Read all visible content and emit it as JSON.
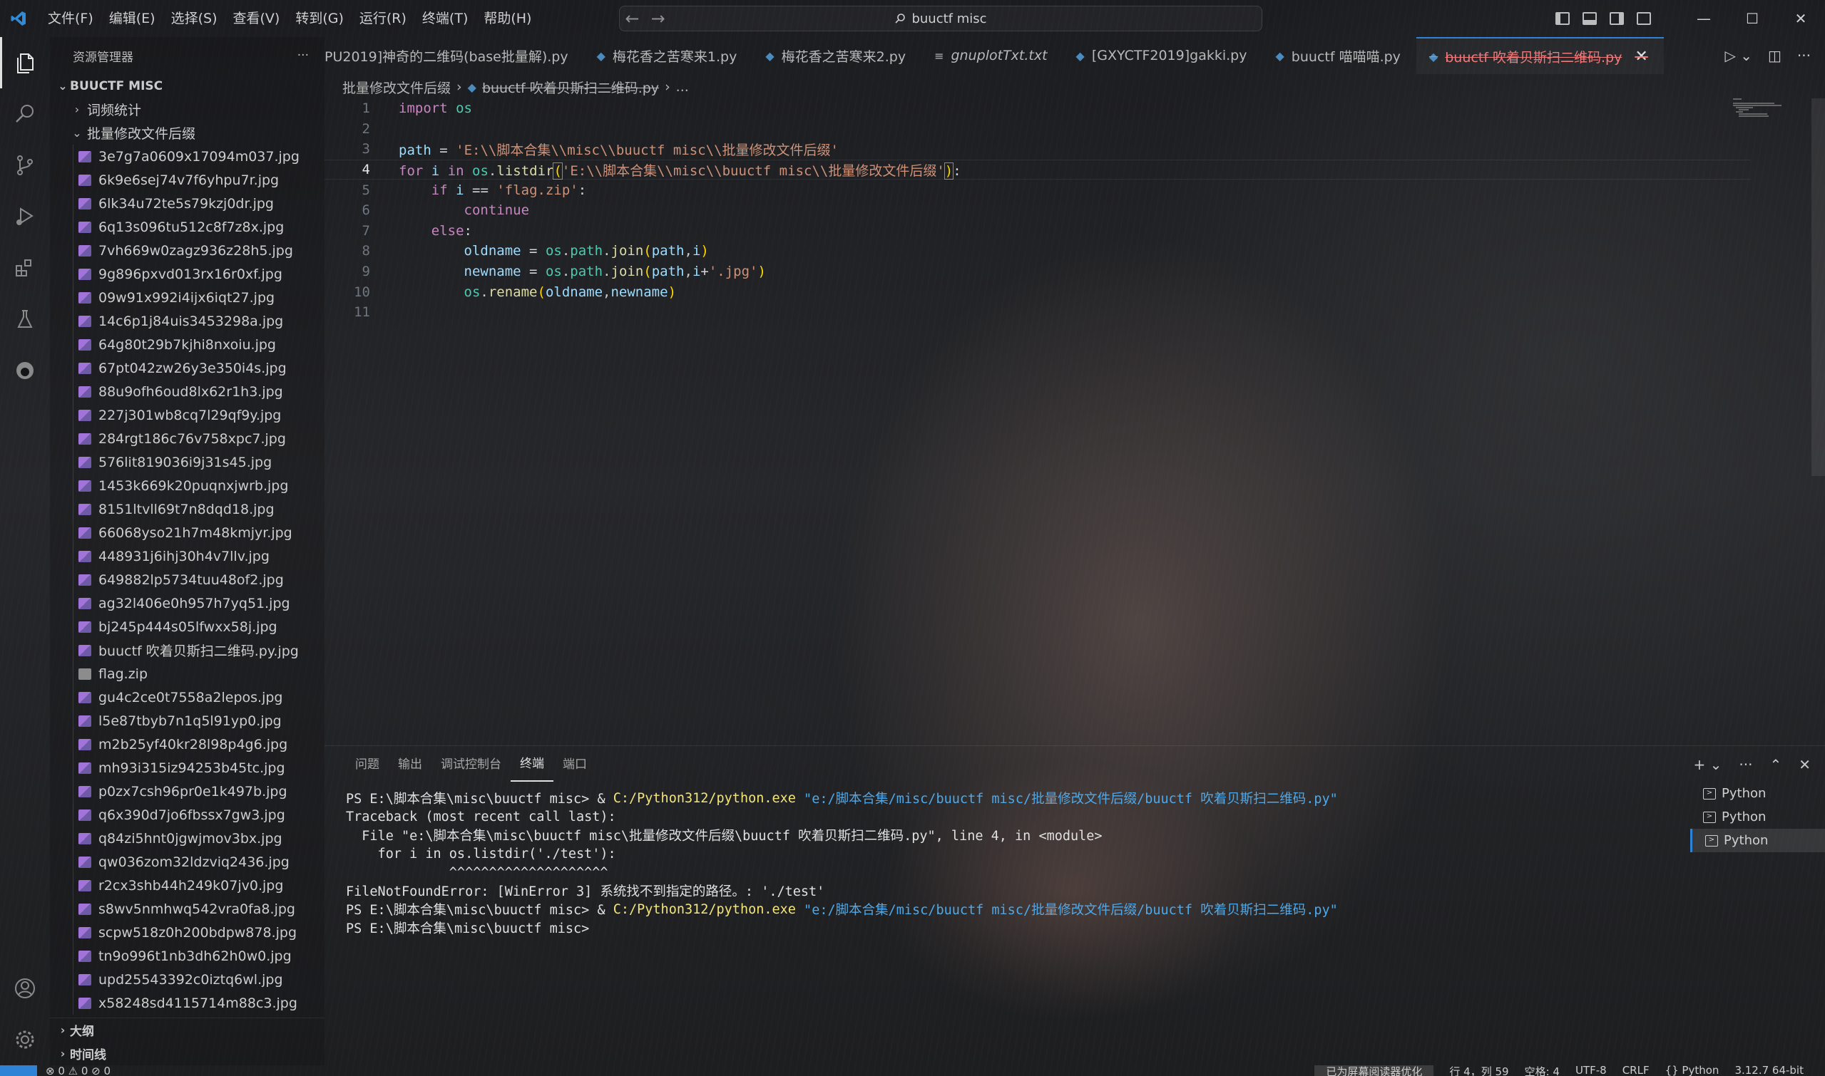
{
  "menu": [
    "文件(F)",
    "编辑(E)",
    "选择(S)",
    "查看(V)",
    "转到(G)",
    "运行(R)",
    "终端(T)",
    "帮助(H)"
  ],
  "search": {
    "text": "buuctf misc"
  },
  "window_controls": [
    "—",
    "☐",
    "✕"
  ],
  "sidebar": {
    "title": "资源管理器",
    "more": "···",
    "root": "BUUCTF MISC",
    "folders": [
      {
        "name": "词频统计",
        "expanded": false
      },
      {
        "name": "批量修改文件后缀",
        "expanded": true
      }
    ],
    "files": [
      "3e7g7a0609x17094m037.jpg",
      "6k9e6sej74v7f6yhpu7r.jpg",
      "6lk34u72te5s79kzj0dr.jpg",
      "6q13s096tu512c8f7z8x.jpg",
      "7vh669w0zagz936z28h5.jpg",
      "9g896pxvd013rx16r0xf.jpg",
      "09w91x992i4ijx6iqt27.jpg",
      "14c6p1j84uis3453298a.jpg",
      "64g80t29b7kjhi8nxoiu.jpg",
      "67pt042zw26y3e350i4s.jpg",
      "88u9ofh6oud8lx62r1h3.jpg",
      "227j301wb8cq7l29qf9y.jpg",
      "284rgt186c76v758xpc7.jpg",
      "576lit819036i9j31s45.jpg",
      "1453k669k20puqnxjwrb.jpg",
      "8151ltvll69t7n8dqd18.jpg",
      "66068yso21h7m48kmjyr.jpg",
      "448931j6ihj30h4v7llv.jpg",
      "649882lp5734tuu48of2.jpg",
      "ag32l406e0h957h7yq51.jpg",
      "bj245p444s05lfwxx58j.jpg",
      "buuctf 吹着贝斯扫二维码.py.jpg",
      "flag.zip",
      "gu4c2ce0t7558a2lepos.jpg",
      "l5e87tbyb7n1q5l91yp0.jpg",
      "m2b25yf40kr28l98p4g6.jpg",
      "mh93i315iz94253b45tc.jpg",
      "p0zx7csh96pr0e1k497b.jpg",
      "q6x390d7jo6fbssx7gw3.jpg",
      "q84zi5hnt0jgwjmov3bx.jpg",
      "qw036zom32ldzviq2436.jpg",
      "r2cx3shb44h249k07jv0.jpg",
      "s8wv5nmhwq542vra0fa8.jpg",
      "scpw518z0h200bdpw878.jpg",
      "tn9o996t1nb3dh62h0w0.jpg",
      "upd25543392c0iztq6wl.jpg",
      "x58248sd4115714m88c3.jpg"
    ],
    "bottom_sections": [
      "大纲",
      "时间线"
    ]
  },
  "tabs": [
    {
      "label": "PU2019]神奇的二维码(base批量解).py",
      "icon": ""
    },
    {
      "label": "梅花香之苦寒来1.py",
      "icon": "python-icon"
    },
    {
      "label": "梅花香之苦寒来2.py",
      "icon": "python-icon"
    },
    {
      "label": "gnuplotTxt.txt",
      "icon": "text-file-icon"
    },
    {
      "label": "[GXYCTF2019]gakki.py",
      "icon": "python-icon"
    },
    {
      "label": "buuctf 喵喵喵.py",
      "icon": "python-icon"
    },
    {
      "label": "buuctf 吹着贝斯扫二维码.py",
      "icon": "python-icon",
      "active": true
    }
  ],
  "breadcrumb": [
    "批量修改文件后缀",
    "buuctf 吹着贝斯扫二维码.py",
    "..."
  ],
  "editor": {
    "current_line": 4,
    "line_numbers": [
      "1",
      "2",
      "3",
      "4",
      "5",
      "6",
      "7",
      "8",
      "9",
      "10",
      "11"
    ]
  },
  "panel": {
    "tabs": [
      "问题",
      "输出",
      "调试控制台",
      "终端",
      "端口"
    ],
    "active_tab": "终端",
    "terminal_lines": [
      {
        "prompt": "PS E:\\脚本合集\\misc\\buuctf misc> & ",
        "exe": "C:/Python312/python.exe",
        "arg": " \"e:/脚本合集/misc/buuctf misc/批量修改文件后缀/buuctf 吹着贝斯扫二维码.py\""
      },
      {
        "text": "Traceback (most recent call last):"
      },
      {
        "text": "  File \"e:\\脚本合集\\misc\\buuctf misc\\批量修改文件后缀\\buuctf 吹着贝斯扫二维码.py\", line 4, in <module>"
      },
      {
        "text": "    for i in os.listdir('./test'):"
      },
      {
        "text": "             ^^^^^^^^^^^^^^^^^^^^"
      },
      {
        "text": "FileNotFoundError: [WinError 3] 系统找不到指定的路径。: './test'"
      },
      {
        "prompt": "PS E:\\脚本合集\\misc\\buuctf misc> & ",
        "exe": "C:/Python312/python.exe",
        "arg": " \"e:/脚本合集/misc/buuctf misc/批量修改文件后缀/buuctf 吹着贝斯扫二维码.py\""
      },
      {
        "text": "PS E:\\脚本合集\\misc\\buuctf misc>"
      }
    ],
    "terminals": [
      "Python",
      "Python",
      "Python"
    ]
  },
  "statusbar": {
    "left": "⊗ 0 ⚠ 0   ⊘ 0",
    "right": [
      "已为屏幕阅读器优化",
      "行 4，列 59",
      "空格: 4",
      "UTF-8",
      "CRLF",
      "{} Python",
      "3.12.7 64-bit"
    ]
  },
  "colors": {
    "accent": "#2f83d6",
    "active_tab_text": "#f07a7a"
  }
}
